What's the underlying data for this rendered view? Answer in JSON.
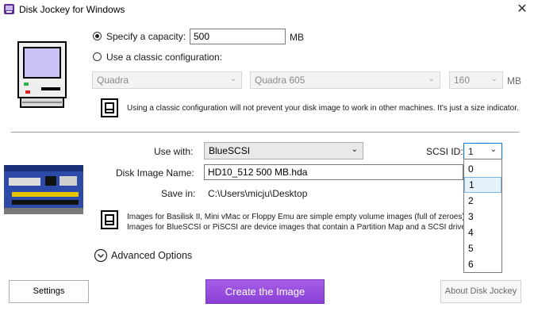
{
  "window": {
    "title": "Disk Jockey for Windows",
    "close": "✕"
  },
  "capacity": {
    "specify_label": "Specify a capacity:",
    "specify_value": "500",
    "unit": "MB",
    "classic_label": "Use a classic configuration:",
    "family": "Quadra",
    "model": "Quadra 605",
    "size": "160",
    "size_unit": "MB",
    "note": "Using a classic configuration will not prevent your disk image to work in other machines. It's just a size indicator."
  },
  "image": {
    "use_with_label": "Use with:",
    "use_with_value": "BlueSCSI",
    "scsi_id_label": "SCSI ID:",
    "scsi_id_value": "1",
    "name_label": "Disk Image Name:",
    "name_value": "HD10_512  500 MB.hda",
    "save_in_label": "Save in:",
    "save_in_value": "C:\\Users\\micju\\Desktop",
    "note_line1": "Images for Basilisk II, Mini vMac or Floppy Emu are simple empty volume images (full of zeroes).",
    "note_line2": "Images for BlueSCSI or PiSCSI are device images that contain a Partition Map and a SCSI driver.",
    "advanced": "Advanced Options"
  },
  "scsi_options": [
    "0",
    "1",
    "2",
    "3",
    "4",
    "5",
    "6"
  ],
  "buttons": {
    "settings": "Settings",
    "create": "Create the Image",
    "about": "About Disk Jockey"
  },
  "colors": {
    "accent": "#8a3fd6",
    "focus": "#0078d7"
  }
}
